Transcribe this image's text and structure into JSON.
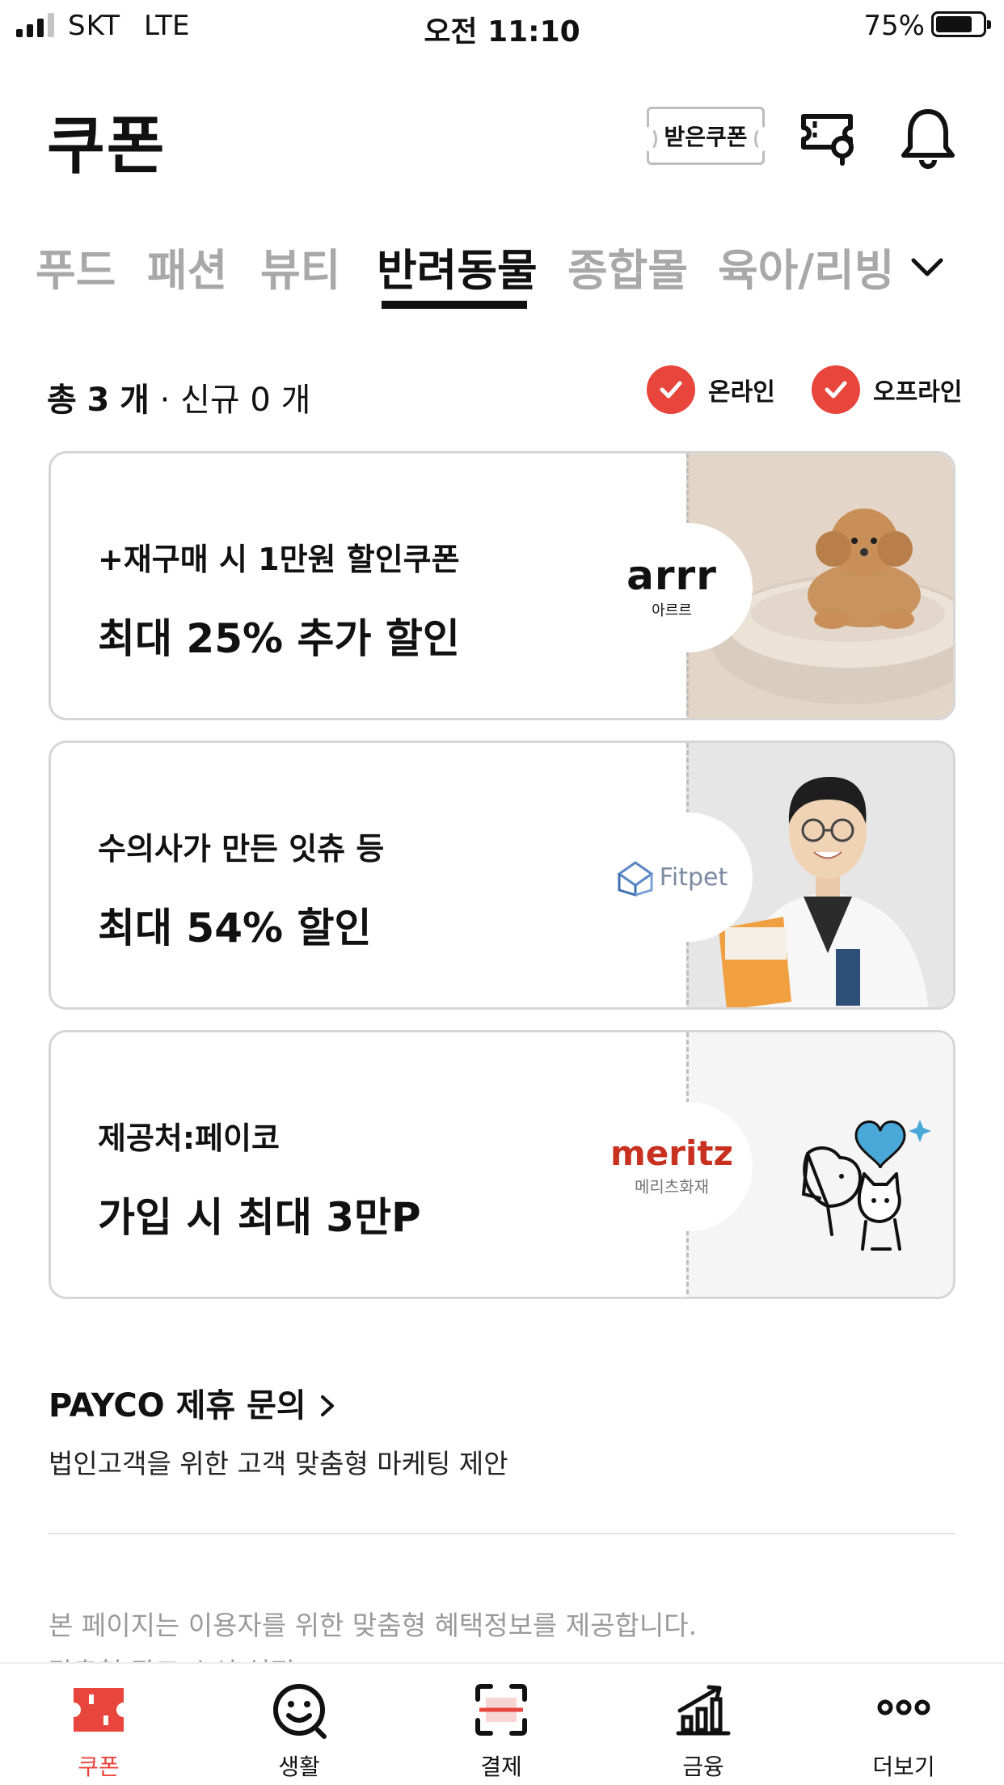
{
  "status_bar": {
    "carrier": "SKT",
    "network": "LTE",
    "time": "오전 11:10",
    "battery": "75%",
    "battery_level": 0.75,
    "signal_bars": 3
  },
  "header": {
    "title": "쿠폰",
    "received_coupon_label": "받은쿠폰"
  },
  "tabs": [
    {
      "label": "푸드",
      "active": false
    },
    {
      "label": "패션",
      "active": false
    },
    {
      "label": "뷰티",
      "active": false
    },
    {
      "label": "반려동물",
      "active": true
    },
    {
      "label": "종합몰",
      "active": false
    },
    {
      "label": "육아/리빙",
      "active": false
    }
  ],
  "summary": {
    "total_prefix": "총",
    "total_count": "3",
    "unit": "개",
    "separator": " · ",
    "new_prefix": "신규",
    "new_count": "0",
    "new_unit": "개"
  },
  "filters": {
    "online_label": "온라인",
    "online_checked": true,
    "offline_label": "오프라인",
    "offline_checked": true
  },
  "coupons": [
    {
      "line1": "+재구매 시 1만원 할인쿠폰",
      "line2": "최대 25% 추가 할인",
      "brand": "arrr",
      "brand_sub": "아르르"
    },
    {
      "line1": "수의사가 만든 잇츄 등",
      "line2": "최대 54% 할인",
      "brand": "Fitpet",
      "brand_sub": ""
    },
    {
      "line1": "제공처:페이코",
      "line2": "가입 시 최대 3만P",
      "brand": "meritz",
      "brand_sub": "메리츠화재"
    }
  ],
  "partnership": {
    "title": "PAYCO 제휴 문의",
    "subtitle": "법인고객을 위한 고객 맞춤형 마케팅 제안"
  },
  "notice": {
    "line1": "본 페이지는 이용자를 위한 맞춤형 혜택정보를 제공합니다.",
    "line2": "맞춤형 광고 수신 설정 >"
  },
  "bottom_nav": [
    {
      "label": "쿠폰",
      "icon": "coupon-icon",
      "active": true
    },
    {
      "label": "생활",
      "icon": "smile-icon",
      "active": false
    },
    {
      "label": "결제",
      "icon": "scan-pay-icon",
      "active": false
    },
    {
      "label": "금융",
      "icon": "chart-icon",
      "active": false
    },
    {
      "label": "더보기",
      "icon": "more-icon",
      "active": false
    }
  ],
  "colors": {
    "accent_red": "#e8453c",
    "inactive_tab": "#a8a8a8",
    "meritz_red": "#c8301f"
  }
}
